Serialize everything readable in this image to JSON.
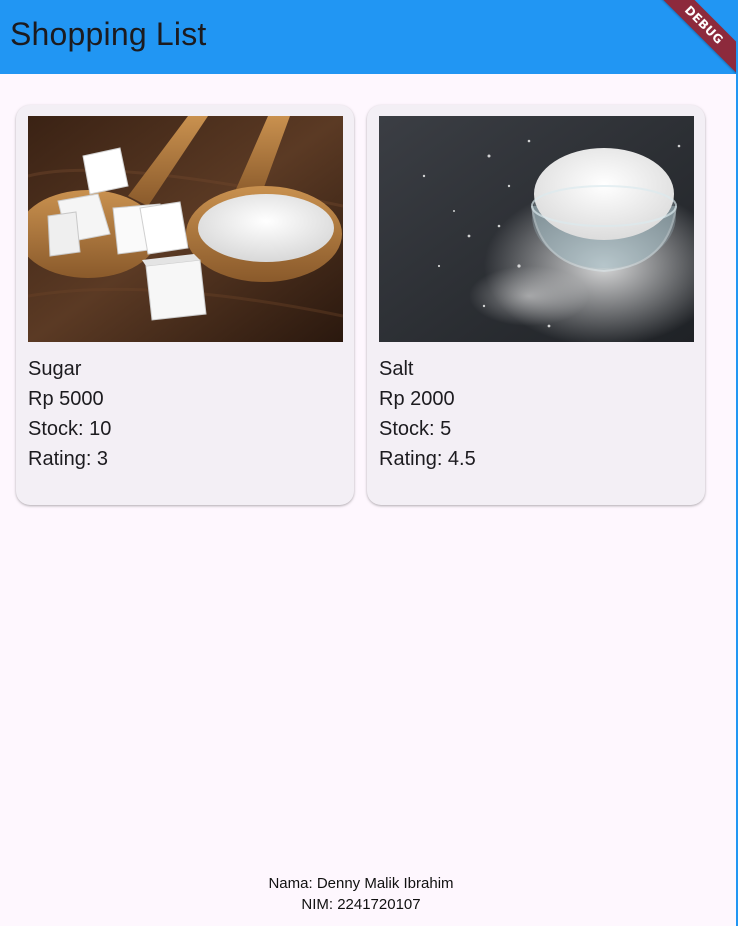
{
  "app": {
    "title": "Shopping List",
    "debug_label": "DEBUG",
    "colors": {
      "appbar": "#2196f3",
      "background": "#fef7fe",
      "card": "#f3eff5",
      "debug_banner": "#8d2a3c"
    }
  },
  "products": [
    {
      "name": "Sugar",
      "price": "Rp 5000",
      "stock": "Stock: 10",
      "rating": "Rating: 3",
      "image_icon": "sugar-photo"
    },
    {
      "name": "Salt",
      "price": "Rp 2000",
      "stock": "Stock: 5",
      "rating": "Rating: 4.5",
      "image_icon": "salt-photo"
    }
  ],
  "footer": {
    "name": "Nama: Denny Malik Ibrahim",
    "nim": "NIM: 2241720107"
  }
}
